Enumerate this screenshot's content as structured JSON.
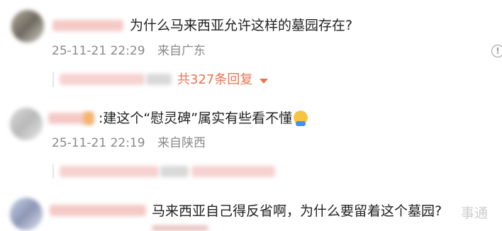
{
  "comments": [
    {
      "text": "为什么马来西亚允许这样的墓园存在?",
      "date": "25-11-21 22:29",
      "location": "来自广东",
      "replies_label": "共327条回复"
    },
    {
      "text": ":建这个“慰灵碑”属实有些看不懂",
      "date": "25-11-21 22:19",
      "location": "来自陕西"
    },
    {
      "text": "马来西亚自己得反省啊，为什么要留着这个墓园?"
    }
  ],
  "watermark": "事通",
  "icons": {
    "report": "exclamation-circle-icon",
    "emoji": "emoji-icon",
    "expand": "caret-down-icon"
  },
  "colors": {
    "accent": "#eb7350",
    "meta": "#8a8a8a"
  }
}
